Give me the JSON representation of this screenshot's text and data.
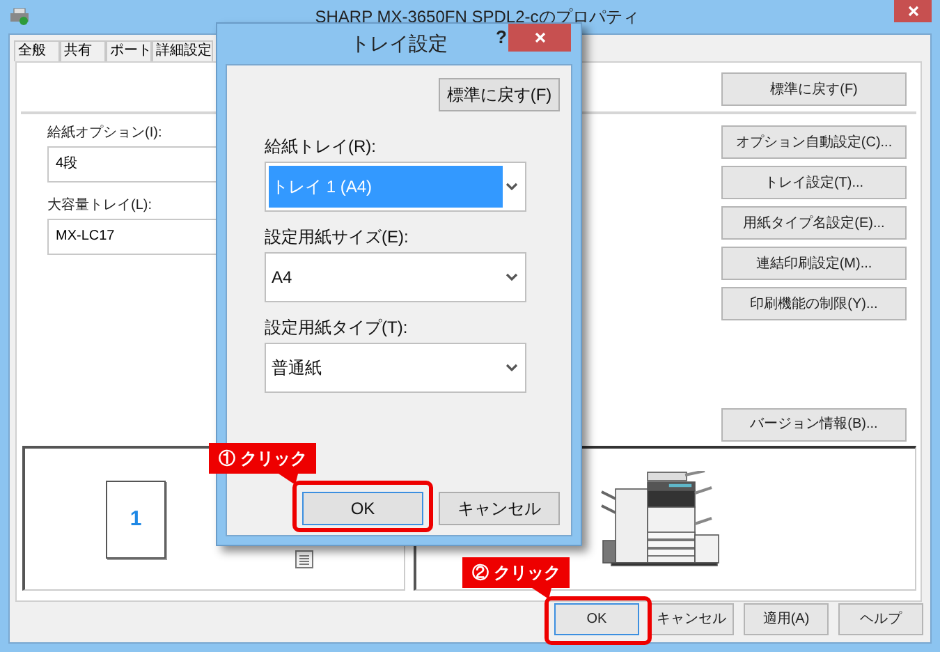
{
  "window": {
    "title": "SHARP MX-3650FN SPDL2-cのプロパティ"
  },
  "tabs": [
    {
      "label": "全般"
    },
    {
      "label": "共有"
    },
    {
      "label": "ポート"
    },
    {
      "label": "詳細設定"
    }
  ],
  "reset_button": "標準に戻す(F)",
  "fields": [
    {
      "label": "給紙オプション(I):",
      "value": "4段"
    },
    {
      "label": "大容量トレイ(L):",
      "value": "MX-LC17"
    }
  ],
  "side_buttons": [
    "オプション自動設定(C)...",
    "トレイ設定(T)...",
    "用紙タイプ名設定(E)...",
    "連結印刷設定(M)...",
    "印刷機能の制限(Y)..."
  ],
  "version_button": "バージョン情報(B)...",
  "preview": {
    "page_number": "1"
  },
  "buttons": [
    {
      "label": "OK",
      "default": true
    },
    {
      "label": "キャンセル",
      "default": false
    },
    {
      "label": "適用(A)",
      "default": false
    },
    {
      "label": "ヘルプ",
      "default": false
    }
  ],
  "dialog": {
    "title": "トレイ設定",
    "help": "?",
    "reset_button": "標準に戻す(F)",
    "fields": [
      {
        "label": "給紙トレイ(R):",
        "value": "トレイ 1 (A4)",
        "highlighted": true
      },
      {
        "label": "設定用紙サイズ(E):",
        "value": "A4",
        "highlighted": false
      },
      {
        "label": "設定用紙タイプ(T):",
        "value": "普通紙",
        "highlighted": false
      }
    ],
    "buttons": [
      {
        "label": "OK",
        "default": true
      },
      {
        "label": "キャンセル",
        "default": false
      }
    ]
  },
  "callouts": [
    {
      "text": "① クリック"
    },
    {
      "text": "② クリック"
    }
  ]
}
